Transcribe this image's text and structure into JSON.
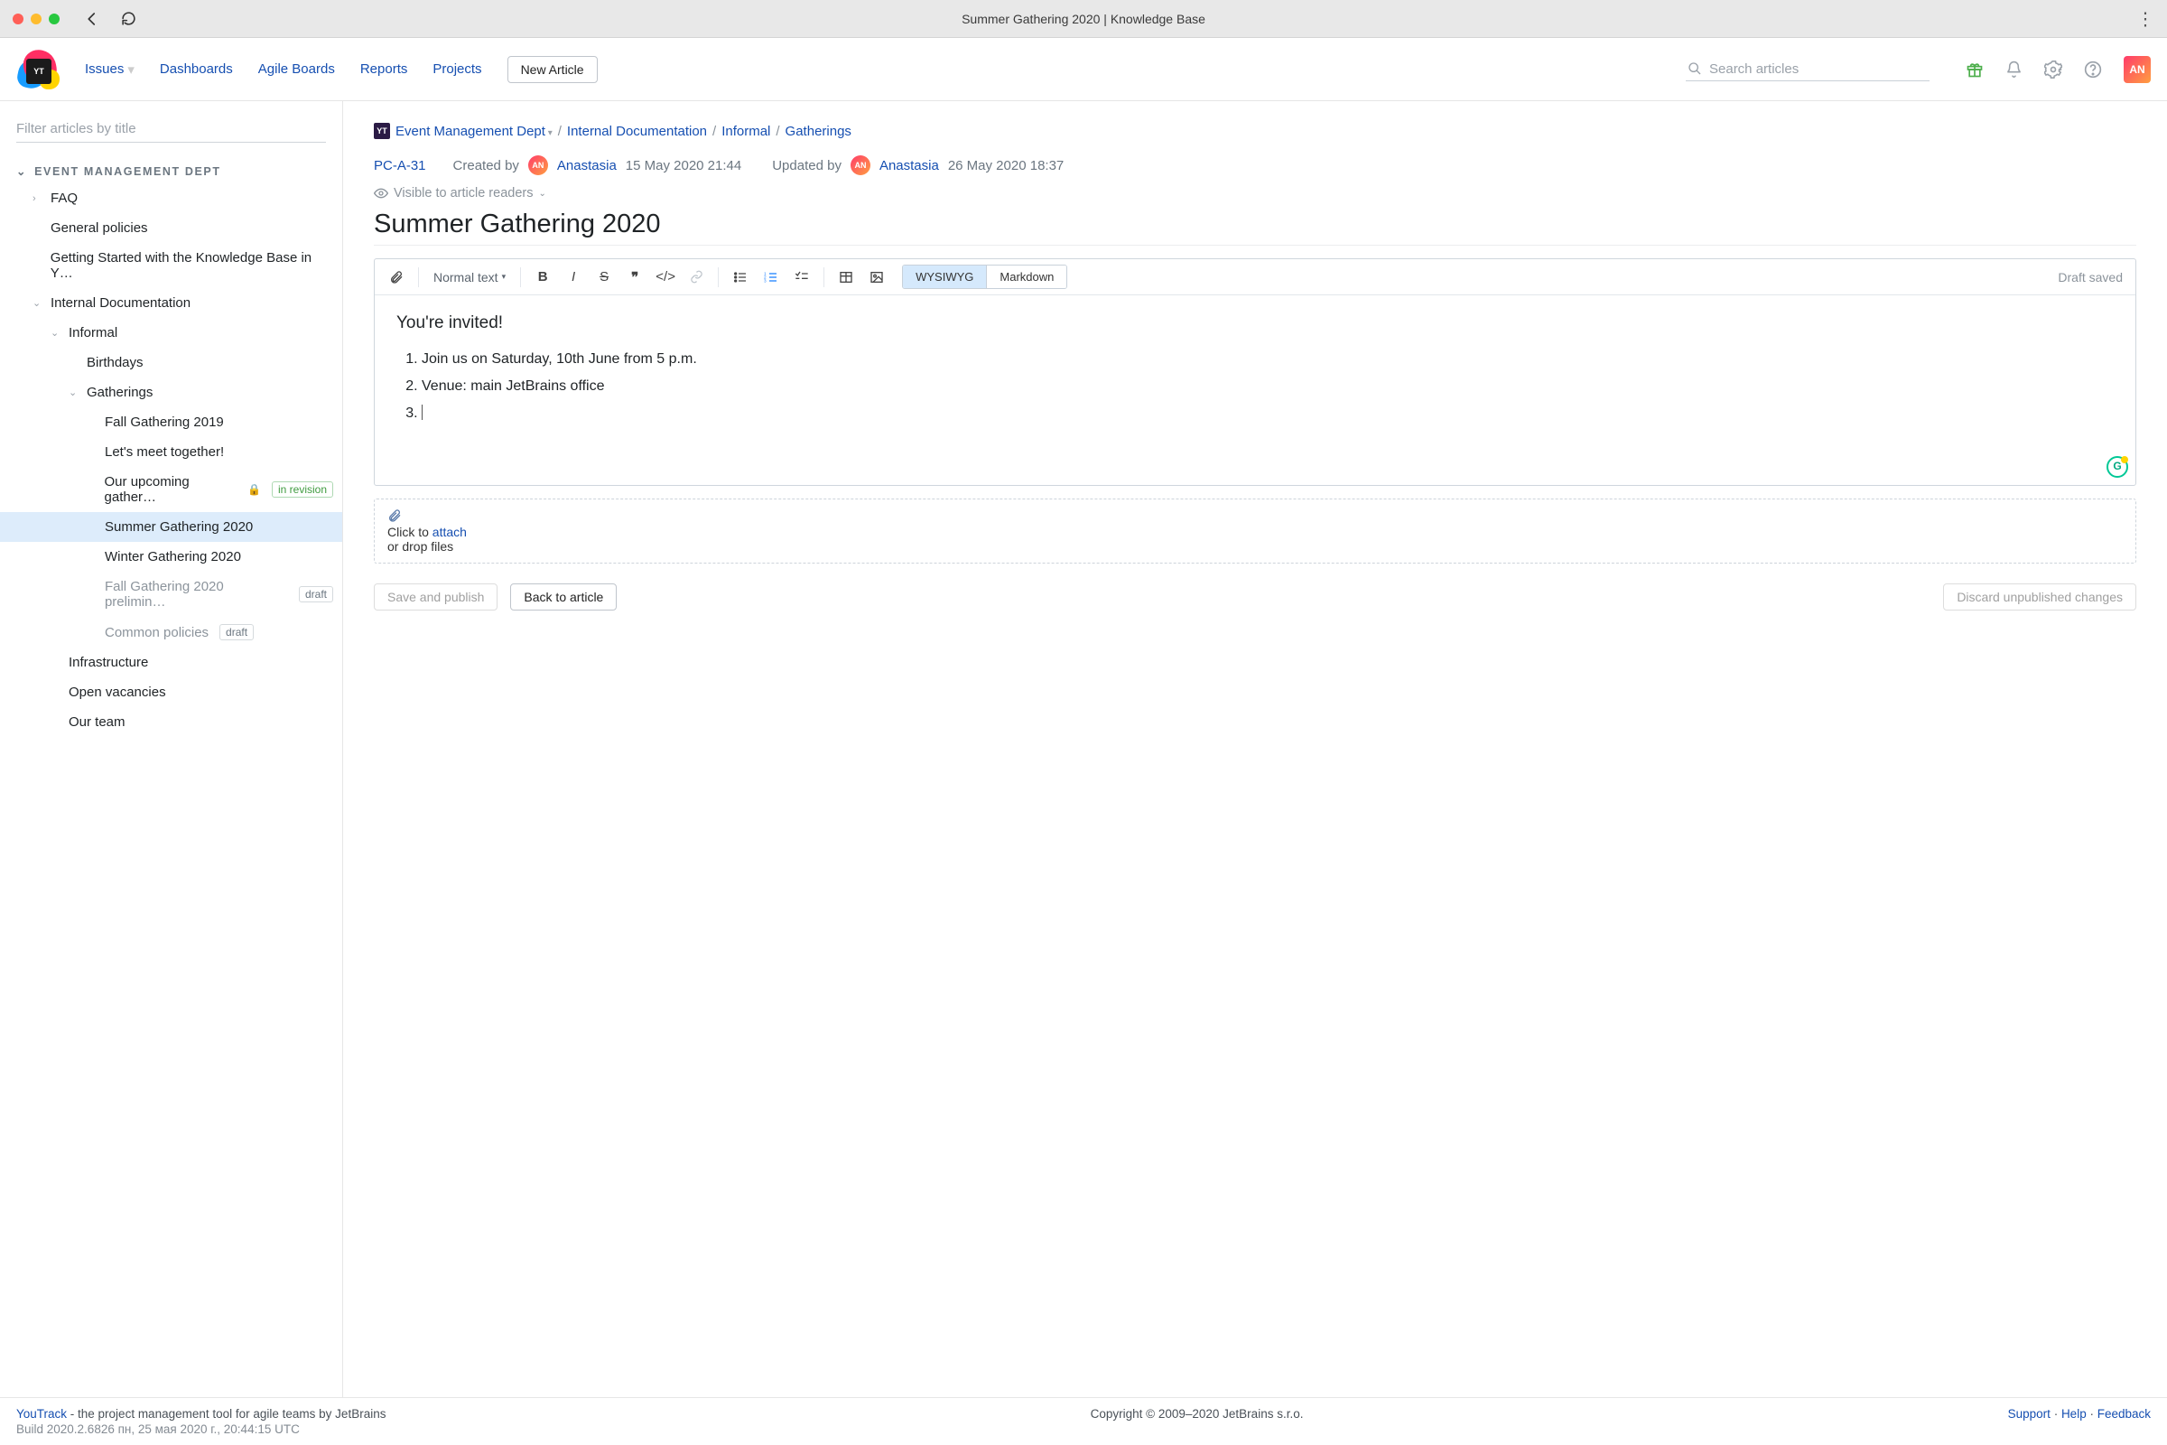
{
  "window": {
    "title": "Summer Gathering 2020 | Knowledge Base"
  },
  "nav": {
    "issues": "Issues",
    "dashboards": "Dashboards",
    "agile": "Agile Boards",
    "reports": "Reports",
    "projects": "Projects",
    "new_article": "New Article",
    "search_placeholder": "Search articles",
    "avatar_initials": "AN"
  },
  "sidebar": {
    "filter_placeholder": "Filter articles by title",
    "section": "EVENT MANAGEMENT DEPT",
    "items": {
      "faq": "FAQ",
      "general_policies": "General policies",
      "getting_started": "Getting Started with the Knowledge Base in Y…",
      "internal_doc": "Internal Documentation",
      "informal": "Informal",
      "birthdays": "Birthdays",
      "gatherings": "Gatherings",
      "fall2019": "Fall Gathering 2019",
      "lets_meet": "Let's meet together!",
      "upcoming": "Our upcoming gather…",
      "summer2020": "Summer Gathering 2020",
      "winter2020": "Winter Gathering 2020",
      "fall2020prelim": "Fall Gathering 2020 prelimin…",
      "common_policies": "Common policies",
      "infrastructure": "Infrastructure",
      "open_vacancies": "Open vacancies",
      "our_team": "Our team"
    },
    "badges": {
      "in_revision": "in revision",
      "draft": "draft"
    }
  },
  "breadcrumb": {
    "root": "Event Management Dept",
    "p1": "Internal Documentation",
    "p2": "Informal",
    "p3": "Gatherings"
  },
  "meta": {
    "id": "PC-A-31",
    "created_by_label": "Created by",
    "created_by": "Anastasia",
    "created_at": "15 May 2020 21:44",
    "updated_by_label": "Updated by",
    "updated_by": "Anastasia",
    "updated_at": "26 May 2020 18:37",
    "avatar_initials": "AN",
    "visibility": "Visible to article readers"
  },
  "article": {
    "title": "Summer Gathering 2020",
    "heading": "You're invited!",
    "items": [
      "Join us on Saturday, 10th June from 5 p.m.",
      "Venue: main JetBrains office",
      ""
    ]
  },
  "toolbar": {
    "style": "Normal text",
    "mode_wysiwyg": "WYSIWYG",
    "mode_markdown": "Markdown",
    "draft_saved": "Draft saved"
  },
  "attach": {
    "pre": "Click to ",
    "link": "attach",
    "sub": "or drop files"
  },
  "actions": {
    "save_publish": "Save and publish",
    "back": "Back to article",
    "discard": "Discard unpublished changes"
  },
  "footer": {
    "app": "YouTrack",
    "tagline": " - the project management tool for agile teams by JetBrains",
    "build": "Build 2020.2.6826 пн, 25 мая 2020 г., 20:44:15 UTC",
    "copyright": "Copyright © 2009–2020 JetBrains s.r.o.",
    "support": "Support",
    "help": "Help",
    "feedback": "Feedback"
  }
}
